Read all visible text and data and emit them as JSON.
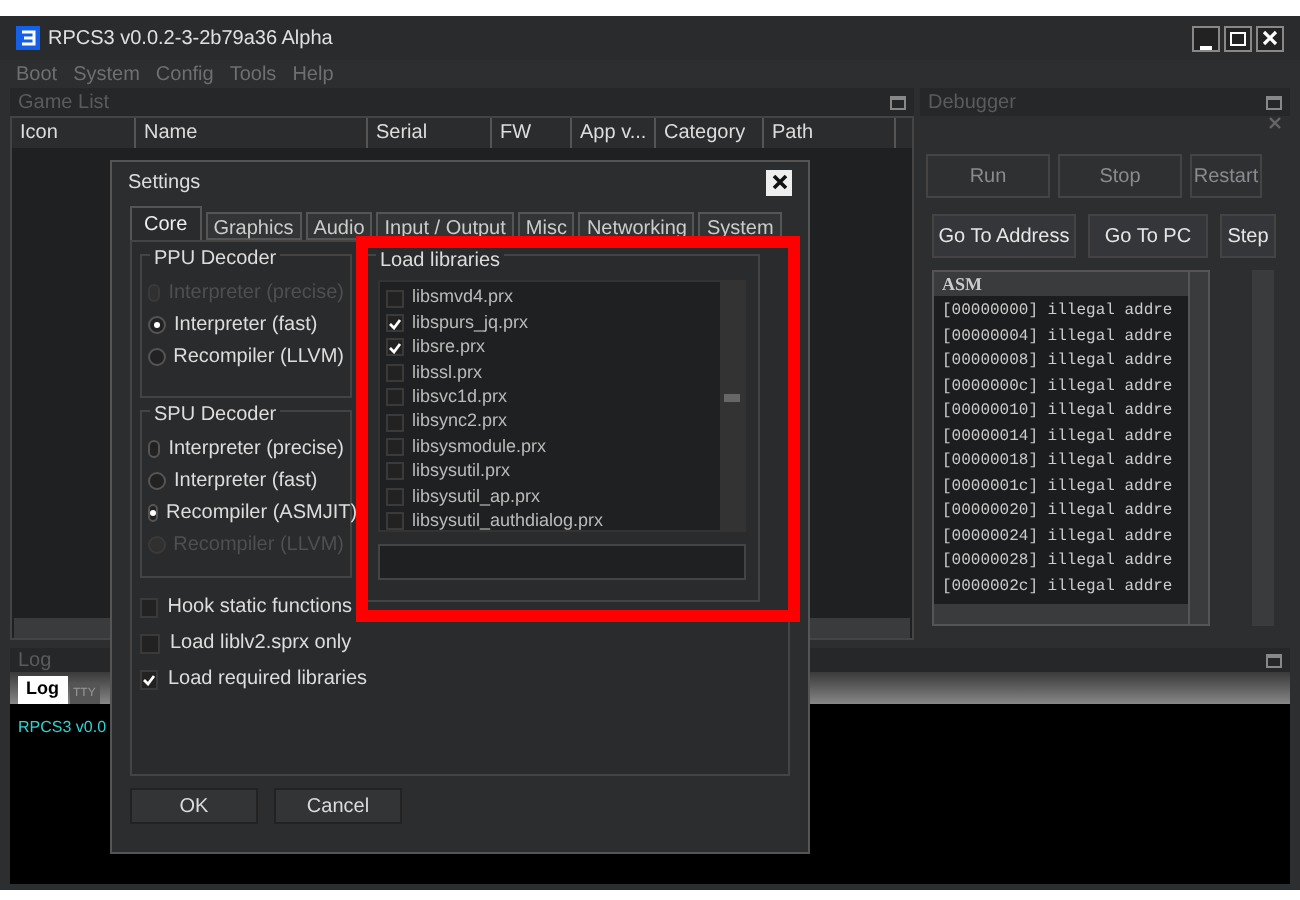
{
  "window": {
    "title": "RPCS3 v0.0.2-3-2b79a36 Alpha"
  },
  "menu": [
    "Boot",
    "System",
    "Config",
    "Tools",
    "Help"
  ],
  "game_list": {
    "title": "Game List",
    "columns": [
      "Icon",
      "Name",
      "Serial",
      "FW",
      "App v...",
      "Category",
      "Path"
    ]
  },
  "debugger": {
    "title": "Debugger",
    "buttons": [
      {
        "label": "Run",
        "disabled": true
      },
      {
        "label": "Stop",
        "disabled": true
      },
      {
        "label": "Restart",
        "disabled": true
      },
      {
        "label": "Go To Address",
        "disabled": false
      },
      {
        "label": "Go To PC",
        "disabled": false
      },
      {
        "label": "Step",
        "disabled": false
      }
    ],
    "asm_header": "ASM",
    "lines": [
      "[00000000] illegal addre",
      "[00000004] illegal addre",
      "[00000008] illegal addre",
      "[0000000c] illegal addre",
      "[00000010] illegal addre",
      "[00000014] illegal addre",
      "[00000018] illegal addre",
      "[0000001c] illegal addre",
      "[00000020] illegal addre",
      "[00000024] illegal addre",
      "[00000028] illegal addre",
      "[0000002c] illegal addre"
    ]
  },
  "log": {
    "title": "Log",
    "tabs": [
      {
        "label": "Log",
        "selected": true
      },
      {
        "label": "TTY",
        "selected": false
      }
    ],
    "text": "RPCS3 v0.0"
  },
  "settings": {
    "title": "Settings",
    "tabs": [
      {
        "label": "Core",
        "selected": true
      },
      {
        "label": "Graphics",
        "selected": false
      },
      {
        "label": "Audio",
        "selected": false
      },
      {
        "label": "Input / Output",
        "selected": false
      },
      {
        "label": "Misc",
        "selected": false
      },
      {
        "label": "Networking",
        "selected": false
      },
      {
        "label": "System",
        "selected": false
      }
    ],
    "ppu": {
      "title": "PPU Decoder",
      "options": [
        {
          "label": "Interpreter (precise)",
          "selected": false,
          "disabled": true
        },
        {
          "label": "Interpreter (fast)",
          "selected": true,
          "disabled": false
        },
        {
          "label": "Recompiler (LLVM)",
          "selected": false,
          "disabled": false
        }
      ]
    },
    "spu": {
      "title": "SPU Decoder",
      "options": [
        {
          "label": "Interpreter (precise)",
          "selected": false,
          "disabled": false
        },
        {
          "label": "Interpreter (fast)",
          "selected": false,
          "disabled": false
        },
        {
          "label": "Recompiler (ASMJIT)",
          "selected": true,
          "disabled": false
        },
        {
          "label": "Recompiler (LLVM)",
          "selected": false,
          "disabled": true
        }
      ]
    },
    "checkboxes": [
      {
        "label": "Hook static functions",
        "checked": false
      },
      {
        "label": "Load liblv2.sprx only",
        "checked": false
      },
      {
        "label": "Load required libraries",
        "checked": true
      }
    ],
    "libraries": {
      "title": "Load libraries",
      "items": [
        {
          "label": "libsmvd4.prx",
          "checked": false
        },
        {
          "label": "libspurs_jq.prx",
          "checked": true
        },
        {
          "label": "libsre.prx",
          "checked": true
        },
        {
          "label": "libssl.prx",
          "checked": false
        },
        {
          "label": "libsvc1d.prx",
          "checked": false
        },
        {
          "label": "libsync2.prx",
          "checked": false
        },
        {
          "label": "libsysmodule.prx",
          "checked": false
        },
        {
          "label": "libsysutil.prx",
          "checked": false
        },
        {
          "label": "libsysutil_ap.prx",
          "checked": false
        },
        {
          "label": "libsysutil_authdialog.prx",
          "checked": false
        }
      ]
    },
    "buttons": [
      "OK",
      "Cancel"
    ]
  }
}
